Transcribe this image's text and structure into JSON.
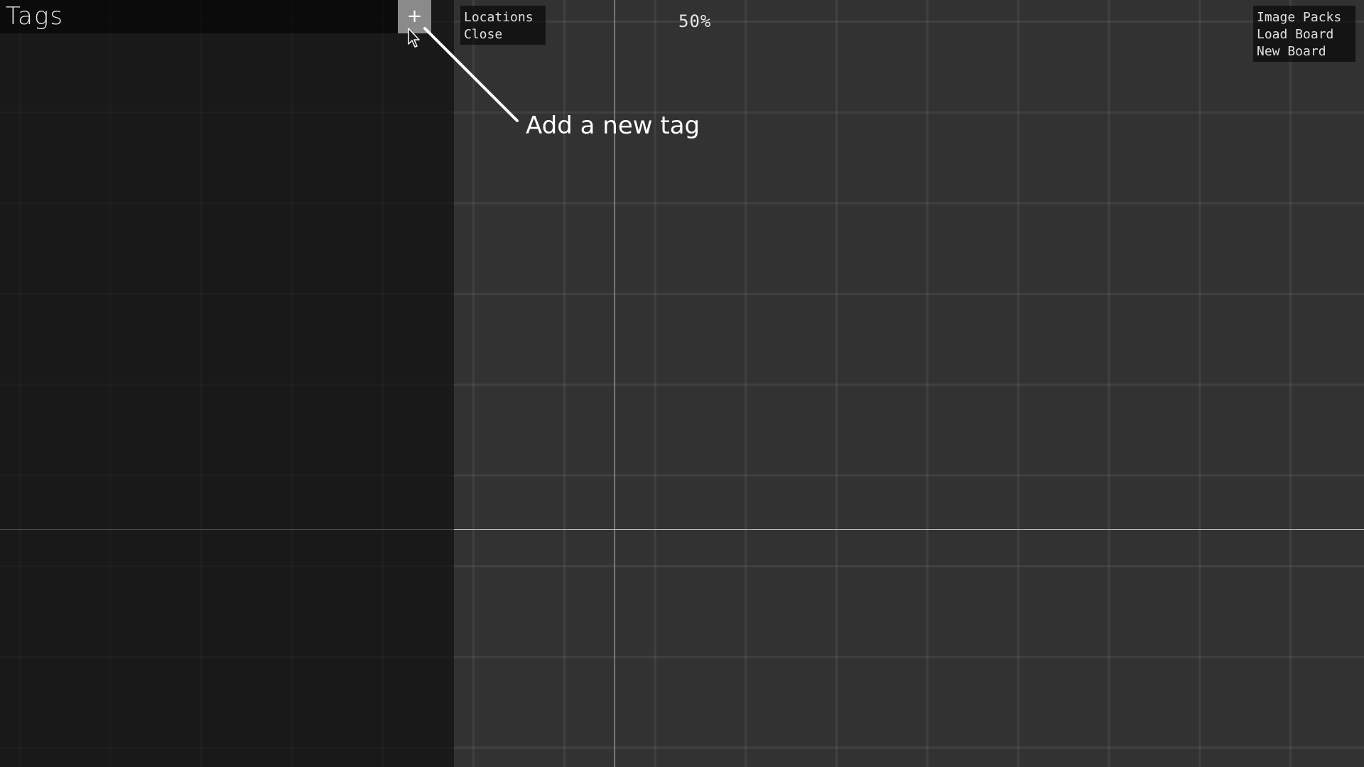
{
  "sidebar": {
    "title": "Tags",
    "add_button_label": "+"
  },
  "menu_left": {
    "items": [
      "Locations",
      "Close"
    ]
  },
  "zoom": {
    "level": "50%"
  },
  "menu_right": {
    "items": [
      "Image Packs",
      "Load Board",
      "New Board"
    ]
  },
  "tooltip": {
    "text": "Add a new tag"
  },
  "colors": {
    "canvas_bg": "#323232",
    "sidebar_bg": "#1a1a1a",
    "add_button_bg": "#8a8a8a",
    "text": "#ffffff"
  },
  "icons": {
    "add": "plus-icon",
    "cursor": "mouse-pointer-icon"
  }
}
